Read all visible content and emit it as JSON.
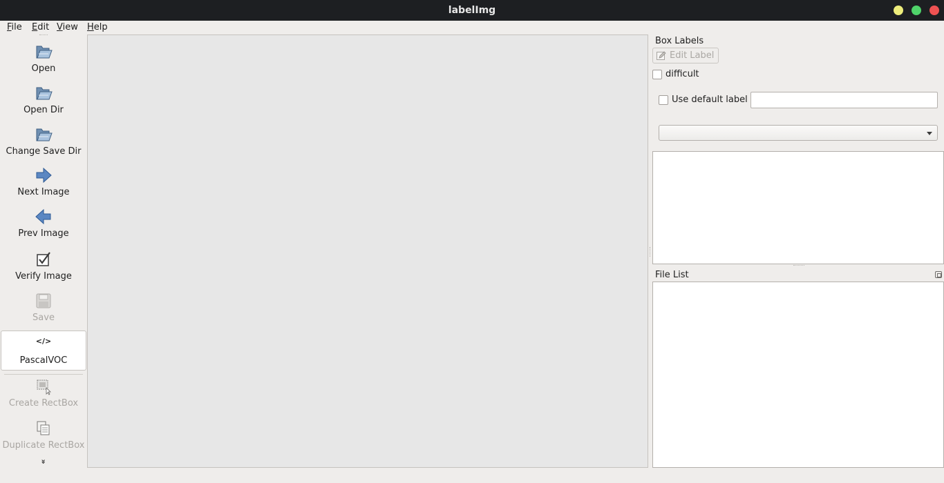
{
  "window": {
    "title": "labelImg"
  },
  "menubar": {
    "items": [
      {
        "mnemonic": "F",
        "rest": "ile"
      },
      {
        "mnemonic": "E",
        "rest": "dit"
      },
      {
        "mnemonic": "V",
        "rest": "iew"
      },
      {
        "mnemonic": "H",
        "rest": "elp"
      }
    ]
  },
  "toolbar": {
    "open": "Open",
    "open_dir": "Open Dir",
    "change_save_dir": "Change Save Dir",
    "next_image": "Next Image",
    "prev_image": "Prev Image",
    "verify_image": "Verify Image",
    "save": "Save",
    "format_icon_text": "</>",
    "format": "PascalVOC",
    "create_rectbox": "Create RectBox",
    "duplicate_rectbox": "Duplicate RectBox",
    "more": "»"
  },
  "box_labels": {
    "title": "Box Labels",
    "edit_label": "Edit Label",
    "difficult": "difficult",
    "use_default_label": "Use default label",
    "default_label_value": "",
    "combo_value": ""
  },
  "file_list": {
    "title": "File List"
  },
  "colors": {
    "titlebar": "#1d1f22",
    "window_bg": "#efedeb",
    "canvas": "#e7e7e7",
    "minimize": "#eded7c",
    "maximize": "#4fd36a",
    "close": "#ef5252"
  }
}
